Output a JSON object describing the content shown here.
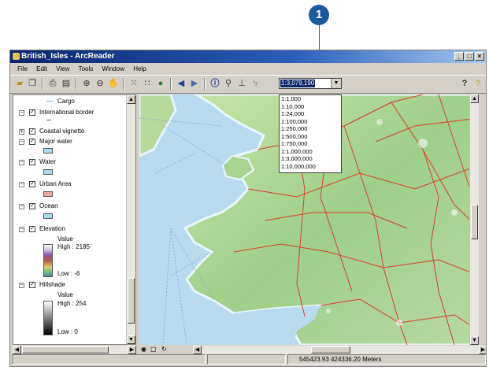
{
  "callout": {
    "number": "1"
  },
  "window": {
    "title": "British_Isles - ArcReader",
    "buttons": [
      "_",
      "□",
      "×"
    ]
  },
  "menu": [
    "File",
    "Edit",
    "View",
    "Tools",
    "Window",
    "Help"
  ],
  "toolbar": {
    "scale_value": "1:3,079,190"
  },
  "scale_options": [
    "1:1,000",
    "1:10,000",
    "1:24,000",
    "1:100,000",
    "1:250,000",
    "1:500,000",
    "1:750,000",
    "1:1,000,000",
    "1:3,000,000",
    "1:10,000,000"
  ],
  "toc": {
    "cargo": "Cargo",
    "international_border": "International border",
    "coastal_vignette": "Coastal vignette",
    "major_water": "Major water",
    "water": "Water",
    "urban_area": "Urban Area",
    "ocean": "Ocean",
    "elevation": "Elevation",
    "elevation_value": "Value",
    "elevation_high": "High : 2185",
    "elevation_low": "Low : -6",
    "hillshade": "Hillshade",
    "hillshade_value": "Value",
    "hillshade_high": "High : 254",
    "hillshade_low": "Low : 0"
  },
  "status": {
    "coordinates": "545423.93  424336.20 Meters"
  },
  "colors": {
    "water": "#a8dcf0",
    "urban": "#f0a8a8",
    "title_start": "#0a246a",
    "road": "#d8402a",
    "land": "#9fcf8a"
  }
}
